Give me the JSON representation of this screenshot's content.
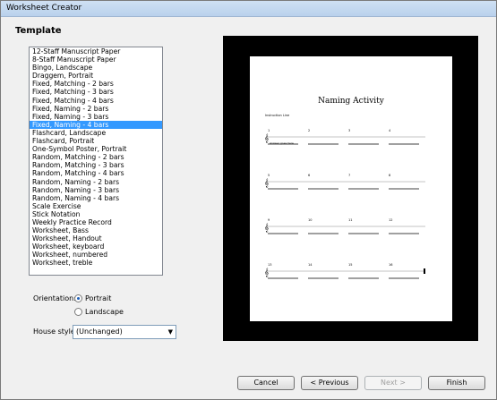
{
  "window": {
    "title": "Worksheet Creator"
  },
  "template": {
    "heading": "Template",
    "items": [
      "12-Staff Manuscript Paper",
      "8-Staff Manuscript Paper",
      "Bingo, Landscape",
      "Draggem, Portrait",
      "Fixed, Matching - 2 bars",
      "Fixed, Matching - 3 bars",
      "Fixed, Matching - 4 bars",
      "Fixed, Naming - 2 bars",
      "Fixed, Naming - 3 bars",
      "Fixed, Naming - 4 bars",
      "Flashcard, Landscape",
      "Flashcard, Portrait",
      "One-Symbol Poster, Portrait",
      "Random, Matching - 2 bars",
      "Random, Matching - 3 bars",
      "Random, Matching - 4 bars",
      "Random, Naming - 2 bars",
      "Random, Naming - 3 bars",
      "Random, Naming - 4 bars",
      "Scale Exercise",
      "Stick Notation",
      "Weekly Practice Record",
      "Worksheet, Bass",
      "Worksheet, Handout",
      "Worksheet, keyboard",
      "Worksheet, numbered",
      "Worksheet, treble"
    ],
    "selected_index": 9
  },
  "orientation": {
    "label": "Orientation:",
    "portrait": "Portrait",
    "landscape": "Landscape",
    "selected": "Portrait"
  },
  "house_style": {
    "label": "House style:",
    "value": "(Unchanged)"
  },
  "preview": {
    "title": "Naming Activity",
    "instructions": "Instruction Line",
    "answer_hint": "Answer goes here",
    "bar_numbers": [
      "1",
      "2",
      "3",
      "4",
      "5",
      "6",
      "7",
      "8",
      "9",
      "10",
      "11",
      "12",
      "13",
      "14",
      "15",
      "16"
    ]
  },
  "buttons": {
    "cancel": "Cancel",
    "previous": "< Previous",
    "next": "Next >",
    "finish": "Finish"
  }
}
